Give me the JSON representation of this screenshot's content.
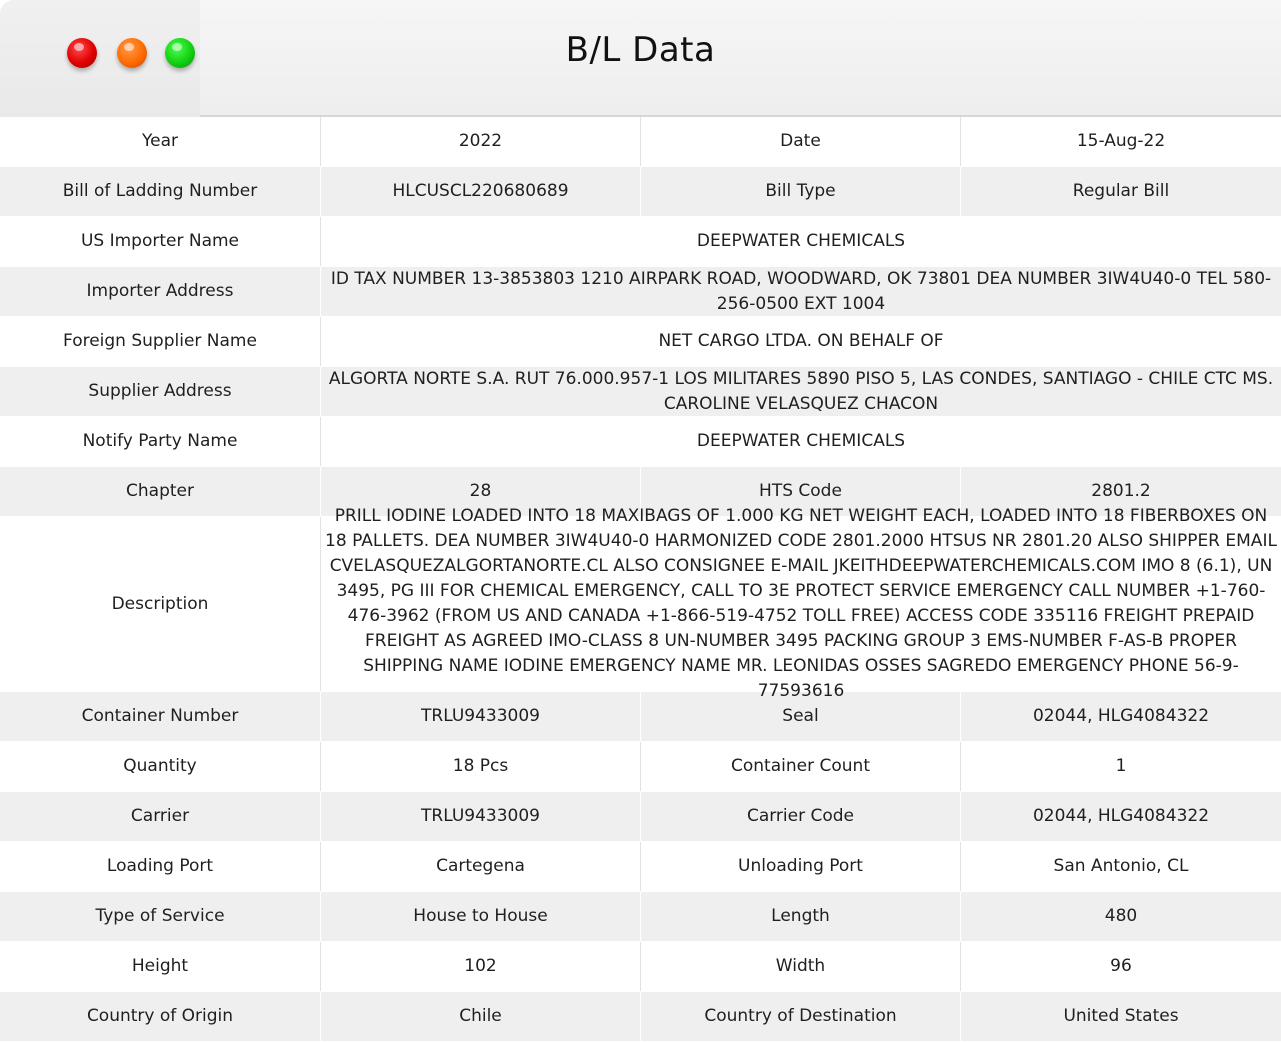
{
  "window": {
    "title": "B/L Data",
    "controls": [
      "close",
      "minimize",
      "maximize"
    ],
    "colors": {
      "close": "#e00000",
      "minimize": "#ff6a00",
      "maximize": "#12d012"
    }
  },
  "rows": {
    "year": {
      "label": "Year",
      "value": "2022",
      "label2": "Date",
      "value2": "15-Aug-22"
    },
    "bill": {
      "label": "Bill of Ladding Number",
      "value": "HLCUSCL220680689",
      "label2": "Bill Type",
      "value2": "Regular Bill"
    },
    "importer_name": {
      "label": "US Importer Name",
      "value": "DEEPWATER CHEMICALS"
    },
    "importer_address": {
      "label": "Importer Address",
      "value": "ID TAX NUMBER 13-3853803 1210 AIRPARK ROAD, WOODWARD, OK 73801 DEA NUMBER 3IW4U40-0 TEL 580-256-0500 EXT 1004"
    },
    "supplier_name": {
      "label": "Foreign Supplier Name",
      "value": "NET CARGO LTDA. ON BEHALF OF"
    },
    "supplier_address": {
      "label": "Supplier Address",
      "value": "ALGORTA NORTE S.A. RUT 76.000.957-1 LOS MILITARES 5890 PISO 5, LAS CONDES, SANTIAGO - CHILE CTC MS. CAROLINE VELASQUEZ CHACON"
    },
    "notify_party": {
      "label": "Notify Party Name",
      "value": "DEEPWATER CHEMICALS"
    },
    "chapter": {
      "label": "Chapter",
      "value": "28",
      "label2": "HTS Code",
      "value2": "2801.2"
    },
    "description": {
      "label": "Description",
      "value": "PRILL IODINE LOADED INTO 18 MAXIBAGS OF 1.000 KG NET WEIGHT EACH, LOADED INTO 18 FIBERBOXES ON 18 PALLETS. DEA NUMBER 3IW4U40-0 HARMONIZED CODE 2801.2000 HTSUS NR 2801.20 ALSO SHIPPER EMAIL CVELASQUEZALGORTANORTE.CL ALSO CONSIGNEE E-MAIL JKEITHDEEPWATERCHEMICALS.COM IMO 8 (6.1), UN 3495, PG III FOR CHEMICAL EMERGENCY, CALL TO 3E PROTECT SERVICE EMERGENCY CALL NUMBER +1-760-476-3962 (FROM US AND CANADA +1-866-519-4752 TOLL FREE) ACCESS CODE 335116 FREIGHT PREPAID FREIGHT AS AGREED IMO-CLASS 8 UN-NUMBER 3495 PACKING GROUP 3 EMS-NUMBER F-AS-B PROPER SHIPPING NAME IODINE EMERGENCY NAME MR. LEONIDAS OSSES SAGREDO EMERGENCY PHONE 56-9-77593616"
    },
    "container": {
      "label": "Container Number",
      "value": "TRLU9433009",
      "label2": "Seal",
      "value2": "02044, HLG4084322"
    },
    "quantity": {
      "label": "Quantity",
      "value": "18 Pcs",
      "label2": "Container Count",
      "value2": "1"
    },
    "carrier": {
      "label": "Carrier",
      "value": "TRLU9433009",
      "label2": "Carrier Code",
      "value2": "02044, HLG4084322"
    },
    "ports": {
      "label": "Loading Port",
      "value": "Cartegena",
      "label2": "Unloading Port",
      "value2": "San Antonio, CL"
    },
    "service": {
      "label": "Type of Service",
      "value": "House to House",
      "label2": "Length",
      "value2": "480"
    },
    "height": {
      "label": "Height",
      "value": "102",
      "label2": "Width",
      "value2": "96"
    },
    "country": {
      "label": "Country of Origin",
      "value": "Chile",
      "label2": "Country of Destination",
      "value2": "United States"
    }
  }
}
